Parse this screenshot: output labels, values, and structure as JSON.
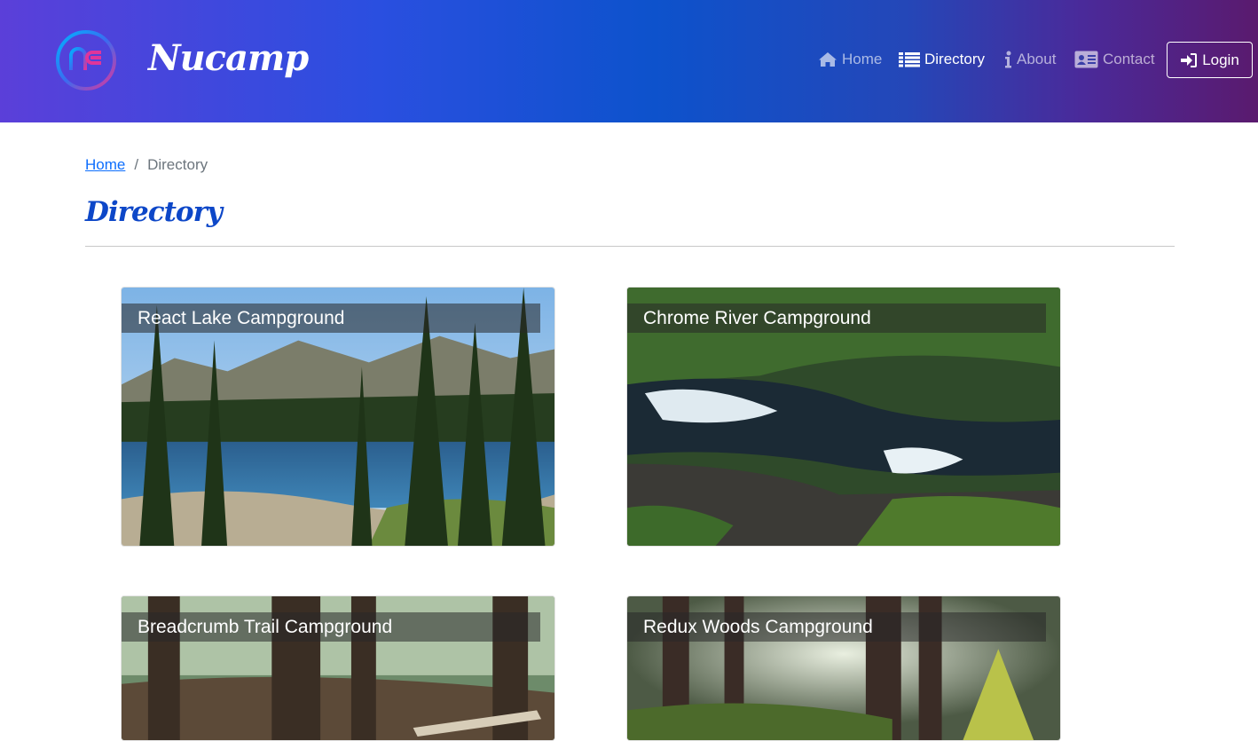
{
  "header": {
    "brand": "Nucamp",
    "logo_text": "nc",
    "nav": [
      {
        "label": "Home",
        "icon": "home-icon"
      },
      {
        "label": "Directory",
        "icon": "list-icon"
      },
      {
        "label": "About",
        "icon": "info-icon"
      },
      {
        "label": "Contact",
        "icon": "address-card-icon"
      }
    ],
    "login_label": "Login",
    "login_icon": "sign-in-icon"
  },
  "breadcrumb": {
    "home": "Home",
    "separator": "/",
    "current": "Directory"
  },
  "page": {
    "title": "Directory"
  },
  "campsites": [
    {
      "name": "React Lake Campground",
      "image": "lake with pine forest"
    },
    {
      "name": "Chrome River Campground",
      "image": "river rapids in forest"
    },
    {
      "name": "Breadcrumb Trail Campground",
      "image": "forest trail with large trees"
    },
    {
      "name": "Redux Woods Campground",
      "image": "sunlit woods"
    }
  ],
  "colors": {
    "brand_blue": "#0d47c8",
    "link_blue": "#0d6efd"
  }
}
